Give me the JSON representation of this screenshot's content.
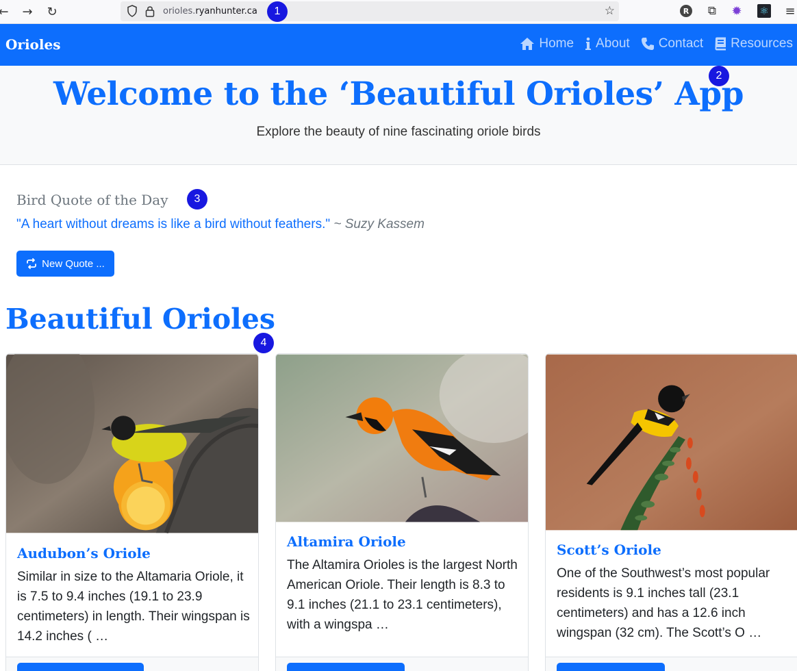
{
  "browser": {
    "url_prefix": "orioles.",
    "url_domain": "ryanhunter.ca",
    "back_glyph": "←",
    "forward_glyph": "→",
    "reload_glyph": "↻",
    "star_glyph": "☆",
    "markers": [
      "1",
      "2",
      "3",
      "4"
    ],
    "extensions": [
      {
        "name": "profile-r",
        "glyph": "R"
      },
      {
        "name": "puzzle",
        "glyph": "⧉"
      },
      {
        "name": "gear-purple",
        "glyph": "✹"
      },
      {
        "name": "react",
        "glyph": "⚛"
      },
      {
        "name": "menu",
        "glyph": "≡"
      }
    ]
  },
  "navbar": {
    "brand": "Orioles",
    "links": [
      {
        "label": "Home",
        "icon": "home-icon"
      },
      {
        "label": "About",
        "icon": "info-icon"
      },
      {
        "label": "Contact",
        "icon": "phone-icon"
      },
      {
        "label": "Resources",
        "icon": "book-icon"
      }
    ]
  },
  "hero": {
    "title": "Welcome to the ‘Beautiful Orioles’ App",
    "subtitle": "Explore the beauty of nine fascinating oriole birds"
  },
  "quote": {
    "title": "Bird Quote of the Day",
    "text": "\"A heart without dreams is like a bird without feathers.\"",
    "author": " ~ Suzy Kassem",
    "button": "New Quote ..."
  },
  "section": {
    "title": "Beautiful Orioles"
  },
  "cards": [
    {
      "title": "Audubon’s Oriole",
      "text": "Similar in size to the Altamaria Oriole, it is 7.5 to 9.4 inches (19.1 to 23.9 centimeters) in length. Their wingspan is 14.2 inches ( …"
    },
    {
      "title": "Altamira Oriole",
      "text": "The Altamira Orioles is the largest North American Oriole. Their length is 8.3 to 9.1 inches (21.1 to 23.1 centimeters), with a wingspa …"
    },
    {
      "title": "Scott’s Oriole",
      "text": "One of the Southwest’s most popular residents is 9.1 inches tall (23.1 centimeters) and has a 12.6 inch wingspan (32 cm). The Scott’s O …"
    }
  ],
  "colors": {
    "primary": "#0d6efd",
    "muted": "#6c757d",
    "light": "#f8f9fa"
  }
}
